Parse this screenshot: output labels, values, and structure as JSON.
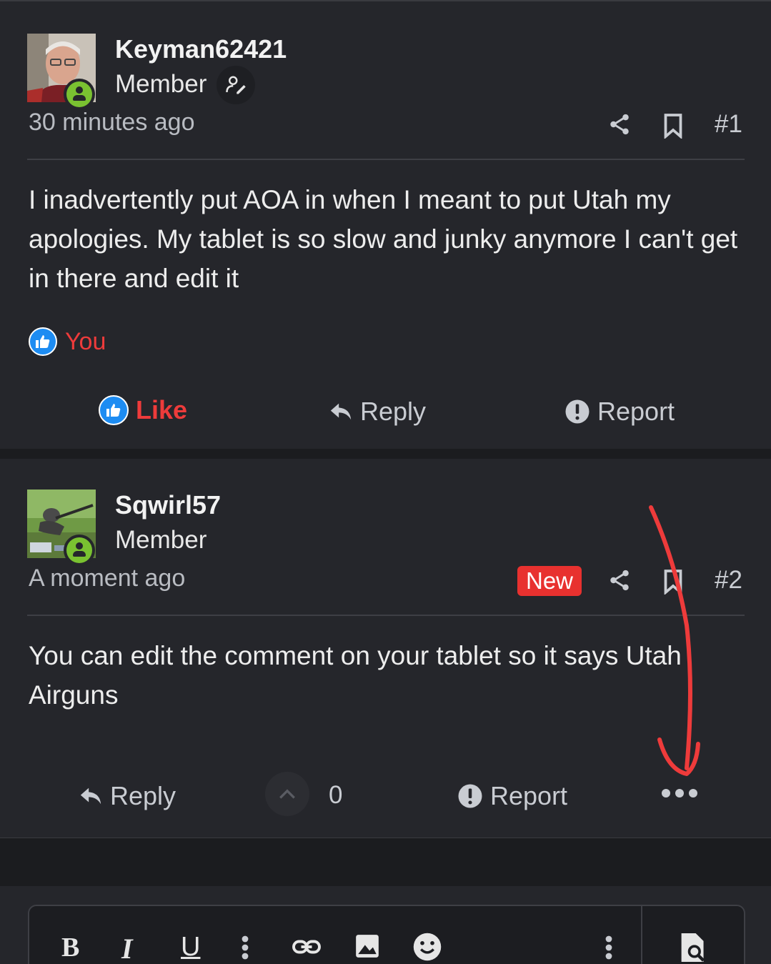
{
  "posts": [
    {
      "username": "Keyman62421",
      "role": "Member",
      "time": "30 minutes ago",
      "post_number": "#1",
      "body": "I inadvertently put AOA in when I meant to put Utah my apologies. My tablet is so slow and junky anymore I can't get in there and edit it",
      "reaction_user": "You",
      "actions": {
        "like": "Like",
        "reply": "Reply",
        "report": "Report"
      }
    },
    {
      "username": "Sqwirl57",
      "role": "Member",
      "time": "A moment ago",
      "badge": "New",
      "post_number": "#2",
      "body": "You can edit the comment on your tablet so it says Utah Airguns",
      "vote_count": "0",
      "actions": {
        "reply": "Reply",
        "report": "Report"
      }
    }
  ],
  "editor": {
    "bold": "B",
    "italic": "I",
    "underline": "U"
  },
  "colors": {
    "background": "#25262b",
    "accent_red": "#ee3b3b",
    "like_blue": "#1d8cf2",
    "online_green": "#7ac231",
    "annotation_arrow": "#ee3b3b"
  },
  "icons": [
    "share-icon",
    "bookmark-icon",
    "reply-icon",
    "report-icon",
    "thumbs-up-icon",
    "more-icon",
    "link-icon",
    "image-icon",
    "emoji-icon",
    "preview-icon"
  ]
}
